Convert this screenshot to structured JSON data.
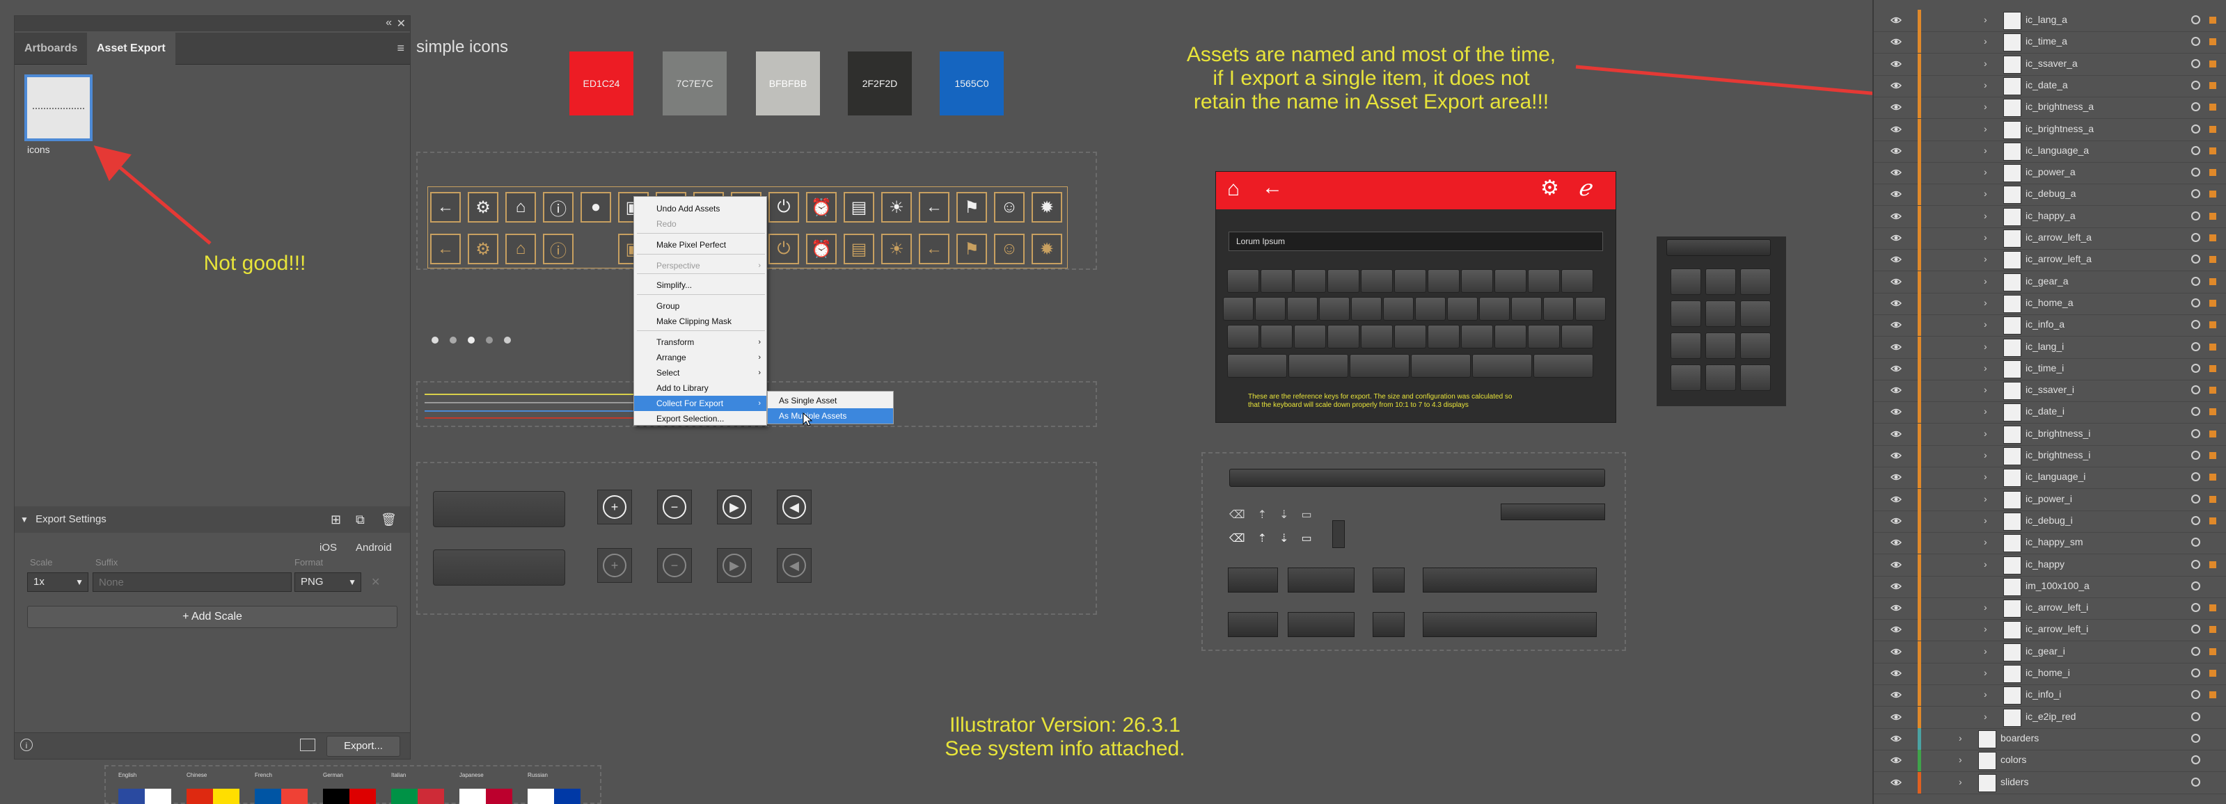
{
  "left_panel": {
    "tabs": [
      "Artboards",
      "Asset Export"
    ],
    "asset_label": "icons",
    "export_settings": {
      "title": "Export Settings",
      "platforms": [
        "iOS",
        "Android"
      ],
      "scale_label": "Scale",
      "suffix_label": "Suffix",
      "format_label": "Format",
      "scale_value": "1x",
      "suffix_placeholder": "None",
      "format_value": "PNG",
      "add_scale": "Add Scale"
    },
    "export_button": "Export..."
  },
  "canvas": {
    "title": "simple icons",
    "swatches": [
      {
        "label": "ED1C24",
        "color": "#ED1C24"
      },
      {
        "label": "7C7E7C",
        "color": "#7C7E7C"
      },
      {
        "label": "BFBFBB",
        "color": "#BFBFBB"
      },
      {
        "label": "2F2F2D",
        "color": "#2F2F2D"
      },
      {
        "label": "1565C0",
        "color": "#1565C0"
      }
    ],
    "note_not_good": "Not good!!!",
    "note_assets": [
      "Assets are named and most of the time,",
      "if I export a single item, it does not",
      "retain the name in Asset Export area!!!"
    ],
    "note_version": [
      "Illustrator Version: 26.3.1",
      "See system info attached."
    ],
    "keyboard_input": "Lorum Ipsum",
    "keyboard_note": [
      "These are the reference keys for export. The size and configuration was calculated so",
      "that the keyboard will scale down properly from 10:1 to 7 to 4.3 displays"
    ],
    "flag_labels": [
      "English",
      "Chinese",
      "French",
      "German",
      "Italian",
      "Japanese",
      "Russian"
    ]
  },
  "context_menu": {
    "items": [
      {
        "label": "Undo Add Assets",
        "disabled": false
      },
      {
        "label": "Redo",
        "disabled": true
      },
      {
        "label": "Make Pixel Perfect",
        "disabled": false
      },
      {
        "label": "Perspective",
        "disabled": true,
        "submenu": true
      },
      {
        "label": "Simplify...",
        "disabled": false
      },
      {
        "label": "Group",
        "disabled": false
      },
      {
        "label": "Make Clipping Mask",
        "disabled": false
      },
      {
        "label": "Transform",
        "disabled": false,
        "submenu": true
      },
      {
        "label": "Arrange",
        "disabled": false,
        "submenu": true
      },
      {
        "label": "Select",
        "disabled": false,
        "submenu": true
      },
      {
        "label": "Add to Library",
        "disabled": false
      },
      {
        "label": "Collect For Export",
        "disabled": false,
        "submenu": true,
        "highlighted": true
      },
      {
        "label": "Export Selection...",
        "disabled": false
      }
    ],
    "submenu": [
      "As Single Asset",
      "As Multiple Assets"
    ]
  },
  "layers": [
    {
      "name": "ic_lang_a",
      "bar": "#e0892a"
    },
    {
      "name": "ic_time_a",
      "bar": "#e0892a"
    },
    {
      "name": "ic_ssaver_a",
      "bar": "#e0892a"
    },
    {
      "name": "ic_date_a",
      "bar": "#e0892a"
    },
    {
      "name": "ic_brightness_a",
      "bar": "#e0892a"
    },
    {
      "name": "ic_brightness_a",
      "bar": "#e0892a"
    },
    {
      "name": "ic_language_a",
      "bar": "#e0892a"
    },
    {
      "name": "ic_power_a",
      "bar": "#e0892a"
    },
    {
      "name": "ic_debug_a",
      "bar": "#e0892a"
    },
    {
      "name": "ic_happy_a",
      "bar": "#e0892a"
    },
    {
      "name": "ic_arrow_left_a",
      "bar": "#e0892a"
    },
    {
      "name": "ic_arrow_left_a",
      "bar": "#e0892a"
    },
    {
      "name": "ic_gear_a",
      "bar": "#e0892a"
    },
    {
      "name": "ic_home_a",
      "bar": "#e0892a"
    },
    {
      "name": "ic_info_a",
      "bar": "#e0892a"
    },
    {
      "name": "ic_lang_i",
      "bar": "#e0892a"
    },
    {
      "name": "ic_time_i",
      "bar": "#e0892a"
    },
    {
      "name": "ic_ssaver_i",
      "bar": "#e0892a"
    },
    {
      "name": "ic_date_i",
      "bar": "#e0892a"
    },
    {
      "name": "ic_brightness_i",
      "bar": "#e0892a"
    },
    {
      "name": "ic_brightness_i",
      "bar": "#e0892a"
    },
    {
      "name": "ic_language_i",
      "bar": "#e0892a"
    },
    {
      "name": "ic_power_i",
      "bar": "#e0892a"
    },
    {
      "name": "ic_debug_i",
      "bar": "#e0892a"
    },
    {
      "name": "ic_happy_sm",
      "bar": "#e0892a"
    },
    {
      "name": "ic_happy",
      "bar": "#e0892a"
    },
    {
      "name": "im_100x100_a",
      "bar": "#e0892a"
    },
    {
      "name": "ic_arrow_left_i",
      "bar": "#e0892a"
    },
    {
      "name": "ic_arrow_left_i",
      "bar": "#e0892a"
    },
    {
      "name": "ic_gear_i",
      "bar": "#e0892a"
    },
    {
      "name": "ic_home_i",
      "bar": "#e0892a"
    },
    {
      "name": "ic_info_i",
      "bar": "#e0892a"
    },
    {
      "name": "ic_e2ip_red",
      "bar": "#e0892a"
    },
    {
      "name": "boarders",
      "bar": "#4aa3a3"
    },
    {
      "name": "colors",
      "bar": "#3fa34a"
    },
    {
      "name": "sliders",
      "bar": "#e06020"
    }
  ]
}
